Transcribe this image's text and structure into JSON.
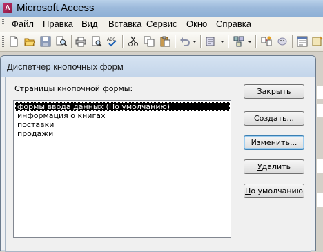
{
  "window": {
    "title": "Microsoft Access"
  },
  "menu": [
    "Файл",
    "Правка",
    "Вид",
    "Вставка",
    "Сервис",
    "Окно",
    "Справка"
  ],
  "toolbar": {
    "icons": [
      "new-icon",
      "open-icon",
      "save-icon",
      "search-icon",
      "print-icon",
      "print-preview-icon",
      "spelling-icon",
      "cut-icon",
      "copy-icon",
      "paste-icon",
      "undo-icon",
      "office-links-icon",
      "analyze-icon",
      "relationships-icon",
      "properties-icon"
    ]
  },
  "dialog": {
    "title": "Диспетчер кнопочных форм",
    "list_label": "Страницы кнопочной формы:",
    "items": [
      "формы ввода данных (По умолчанию)",
      "информация о книгах",
      "поставки",
      "продажи"
    ],
    "selected_index": 0,
    "buttons": {
      "close": {
        "accel": "З",
        "rest": "акрыть"
      },
      "create": {
        "accel": "",
        "pre": "Со",
        "accel2": "з",
        "rest": "дать..."
      },
      "edit": {
        "pre": "",
        "accel": "И",
        "rest": "зменить..."
      },
      "delete": {
        "pre": "",
        "accel": "У",
        "rest": "далить"
      },
      "default": {
        "pre": "",
        "accel": "П",
        "rest": "о умолчанию"
      }
    }
  },
  "colors": {
    "selection": "#000000",
    "title_gradient": "#b9d1ea",
    "dialog_bg": "#f0f0f0"
  }
}
